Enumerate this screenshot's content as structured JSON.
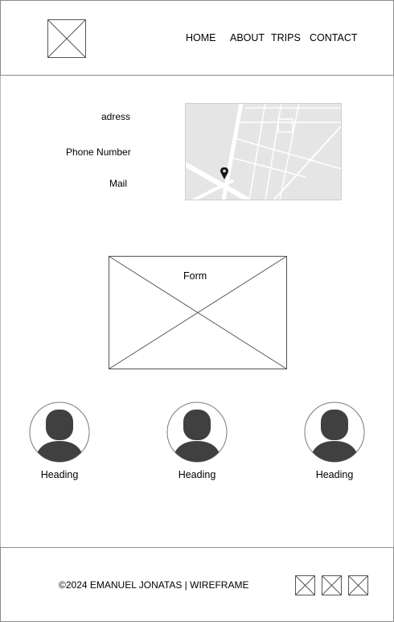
{
  "nav": {
    "home": "HOME",
    "about": "ABOUT",
    "trips": "TRIPS",
    "contact": "CONTACT"
  },
  "contact": {
    "address": "adress",
    "phone": "Phone Number",
    "mail": "Mail"
  },
  "map": {
    "marker_icon": "map-pin-icon"
  },
  "form": {
    "label": "Form"
  },
  "team": [
    {
      "heading": "Heading",
      "icon": "user-avatar-icon"
    },
    {
      "heading": "Heading",
      "icon": "user-avatar-icon"
    },
    {
      "heading": "Heading",
      "icon": "user-avatar-icon"
    }
  ],
  "footer": {
    "copyright": "©2024 EMANUEL JONATAS | WIREFRAME"
  },
  "colors": {
    "border": "#8c8c8c",
    "map_background": "#e5e5e5",
    "avatar_fill": "#404040"
  }
}
